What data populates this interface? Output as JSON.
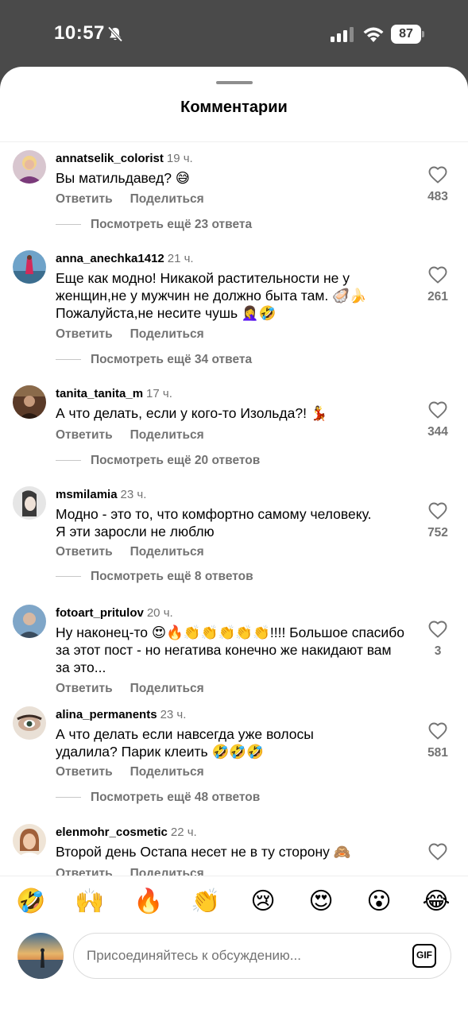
{
  "status_bar": {
    "time": "10:57",
    "battery": "87",
    "icons": [
      "bell-slash-icon",
      "signal-icon",
      "wifi-icon",
      "battery-icon"
    ]
  },
  "sheet": {
    "title": "Комментарии"
  },
  "actions": {
    "reply": "Ответить",
    "share": "Поделиться"
  },
  "comments": [
    {
      "username": "annatselik_colorist",
      "time": "19 ч.",
      "text": "Вы матильдавед? 😅",
      "likes": "483",
      "more_replies": "Посмотреть ещё 23 ответа"
    },
    {
      "username": "anna_anechka1412",
      "time": "21 ч.",
      "text": "Еще как модно! Никакой растительности не у женщин,не у мужчин не должно быта там. 🦪🍌 Пожалуйста,не несите чушь 🤦‍♀️🤣",
      "likes": "261",
      "more_replies": "Посмотреть ещё 34 ответа"
    },
    {
      "username": "tanita_tanita_m",
      "time": "17 ч.",
      "text": "А что делать, если у кого-то Изольда?! 💃",
      "likes": "344",
      "more_replies": "Посмотреть ещё 20 ответов"
    },
    {
      "username": "msmilamia",
      "time": "23 ч.",
      "text": "Модно - это то, что комфортно самому человеку. Я эти заросли не люблю",
      "likes": "752",
      "more_replies": "Посмотреть ещё 8 ответов"
    },
    {
      "username": "fotoart_pritulov",
      "time": "20 ч.",
      "text": "Ну наконец-то 😍🔥👏👏👏👏👏!!!! Большое спасибо за этот пост - но негатива конечно же накидают вам за это...",
      "likes": "3",
      "more_replies": ""
    },
    {
      "username": "alina_permanents",
      "time": "23 ч.",
      "text": "А что делать если навсегда уже волосы удалила? Парик клеить 🤣🤣🤣",
      "likes": "581",
      "more_replies": "Посмотреть ещё 48 ответов"
    },
    {
      "username": "elenmohr_cosmetic",
      "time": "22 ч.",
      "text": "Второй день Остапа несет не в ту сторону 🙈",
      "likes": "",
      "more_replies": ""
    }
  ],
  "emoji_bar": [
    "🤣",
    "🙌",
    "🔥",
    "👏",
    "😢",
    "😍",
    "😮",
    "😂"
  ],
  "composer": {
    "placeholder": "Присоединяйтесь к обсуждению...",
    "gif_label": "GIF"
  }
}
